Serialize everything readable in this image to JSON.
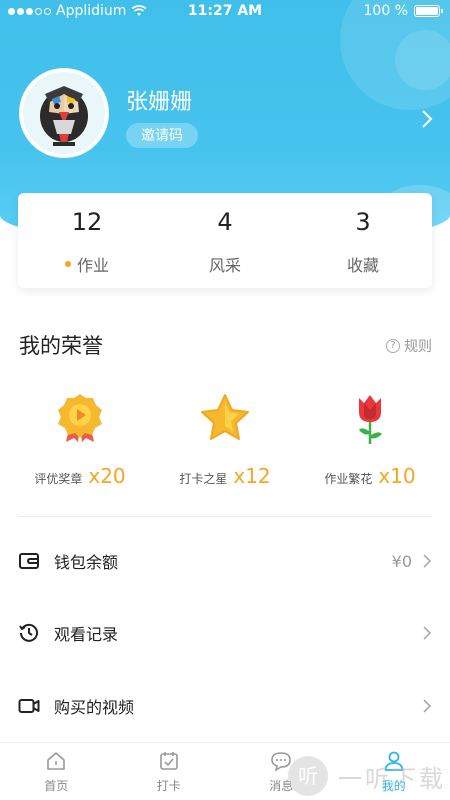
{
  "status": {
    "carrier": "Applidium",
    "time": "11:27 AM",
    "battery": "100 %",
    "signal_bars": 3
  },
  "profile": {
    "name": "张姗姗",
    "invite_label": "邀请码"
  },
  "stats": [
    {
      "value": "12",
      "label": "作业"
    },
    {
      "value": "4",
      "label": "风采"
    },
    {
      "value": "3",
      "label": "收藏"
    }
  ],
  "honors": {
    "title": "我的荣誉",
    "rules_label": "规则",
    "items": [
      {
        "name": "评优奖章",
        "count": "x20"
      },
      {
        "name": "打卡之星",
        "count": "x12"
      },
      {
        "name": "作业繁花",
        "count": "x10"
      }
    ]
  },
  "menu": [
    {
      "label": "钱包余额",
      "value": "¥0"
    },
    {
      "label": "观看记录",
      "value": ""
    },
    {
      "label": "购买的视频",
      "value": ""
    }
  ],
  "tabs": [
    {
      "label": "首页"
    },
    {
      "label": "打卡"
    },
    {
      "label": "消息"
    },
    {
      "label": "我的"
    }
  ],
  "watermark": {
    "text": "一听下载",
    "icon_label": "听"
  },
  "colors": {
    "accent": "#2fb6e8",
    "header": "#46c3ee",
    "gold": "#f5a623"
  }
}
